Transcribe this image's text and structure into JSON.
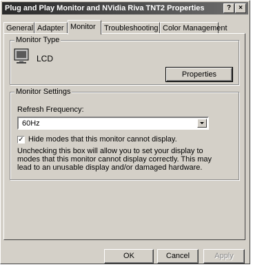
{
  "window": {
    "title": "Plug and Play Monitor and NVidia Riva TNT2 Properties",
    "help_glyph": "?",
    "close_glyph": "×"
  },
  "tabs": [
    {
      "label": "General"
    },
    {
      "label": "Adapter"
    },
    {
      "label": "Monitor"
    },
    {
      "label": "Troubleshooting"
    },
    {
      "label": "Color Management"
    }
  ],
  "monitor_type": {
    "legend": "Monitor Type",
    "name": "LCD",
    "properties_button": "Properties"
  },
  "monitor_settings": {
    "legend": "Monitor Settings",
    "refresh_label": "Refresh Frequency:",
    "refresh_value": "60Hz",
    "hide_modes_label": "Hide modes that this monitor cannot display.",
    "hide_modes_checked": true,
    "description": "Unchecking this box will allow you to set your display to modes that this monitor cannot display correctly. This may lead to an unusable display and/or damaged hardware."
  },
  "footer": {
    "ok": "OK",
    "cancel": "Cancel",
    "apply": "Apply"
  }
}
